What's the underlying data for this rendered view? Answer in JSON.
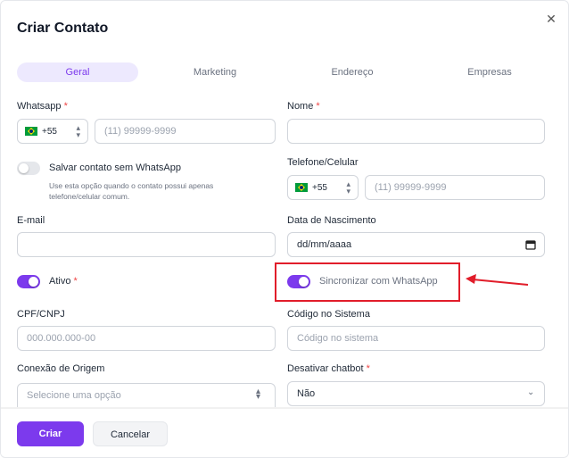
{
  "modal": {
    "title": "Criar Contato",
    "close_icon": "close-icon"
  },
  "tabs": [
    {
      "label": "Geral",
      "active": true
    },
    {
      "label": "Marketing",
      "active": false
    },
    {
      "label": "Endereço",
      "active": false
    },
    {
      "label": "Empresas",
      "active": false
    }
  ],
  "form": {
    "whatsapp": {
      "label": "Whatsapp",
      "required_mark": "*",
      "country_code": "+55",
      "placeholder": "(11) 99999-9999"
    },
    "nome": {
      "label": "Nome",
      "required_mark": "*",
      "value": ""
    },
    "salvar_sem_whatsapp": {
      "label": "Salvar contato sem WhatsApp",
      "help": "Use esta opção quando o contato possui apenas telefone/celular comum.",
      "on": false
    },
    "telefone": {
      "label": "Telefone/Celular",
      "country_code": "+55",
      "placeholder": "(11) 99999-9999"
    },
    "email": {
      "label": "E-mail",
      "value": ""
    },
    "data_nascimento": {
      "label": "Data de Nascimento",
      "value": "dd/mm/aaaa"
    },
    "ativo": {
      "label": "Ativo",
      "required_mark": "*",
      "on": true
    },
    "sincronizar": {
      "label": "Sincronizar com WhatsApp",
      "on": true
    },
    "cpf": {
      "label": "CPF/CNPJ",
      "placeholder": "000.000.000-00"
    },
    "codigo": {
      "label": "Código no Sistema",
      "placeholder": "Código no sistema"
    },
    "conexao": {
      "label": "Conexão de Origem",
      "placeholder": "Selecione uma opção"
    },
    "chatbot": {
      "label": "Desativar chatbot",
      "required_mark": "*",
      "value": "Não"
    }
  },
  "buttons": {
    "criar": "Criar",
    "cancelar": "Cancelar"
  },
  "colors": {
    "accent": "#7c3aed",
    "annotation": "#e11d2a",
    "required": "#ef4444"
  }
}
